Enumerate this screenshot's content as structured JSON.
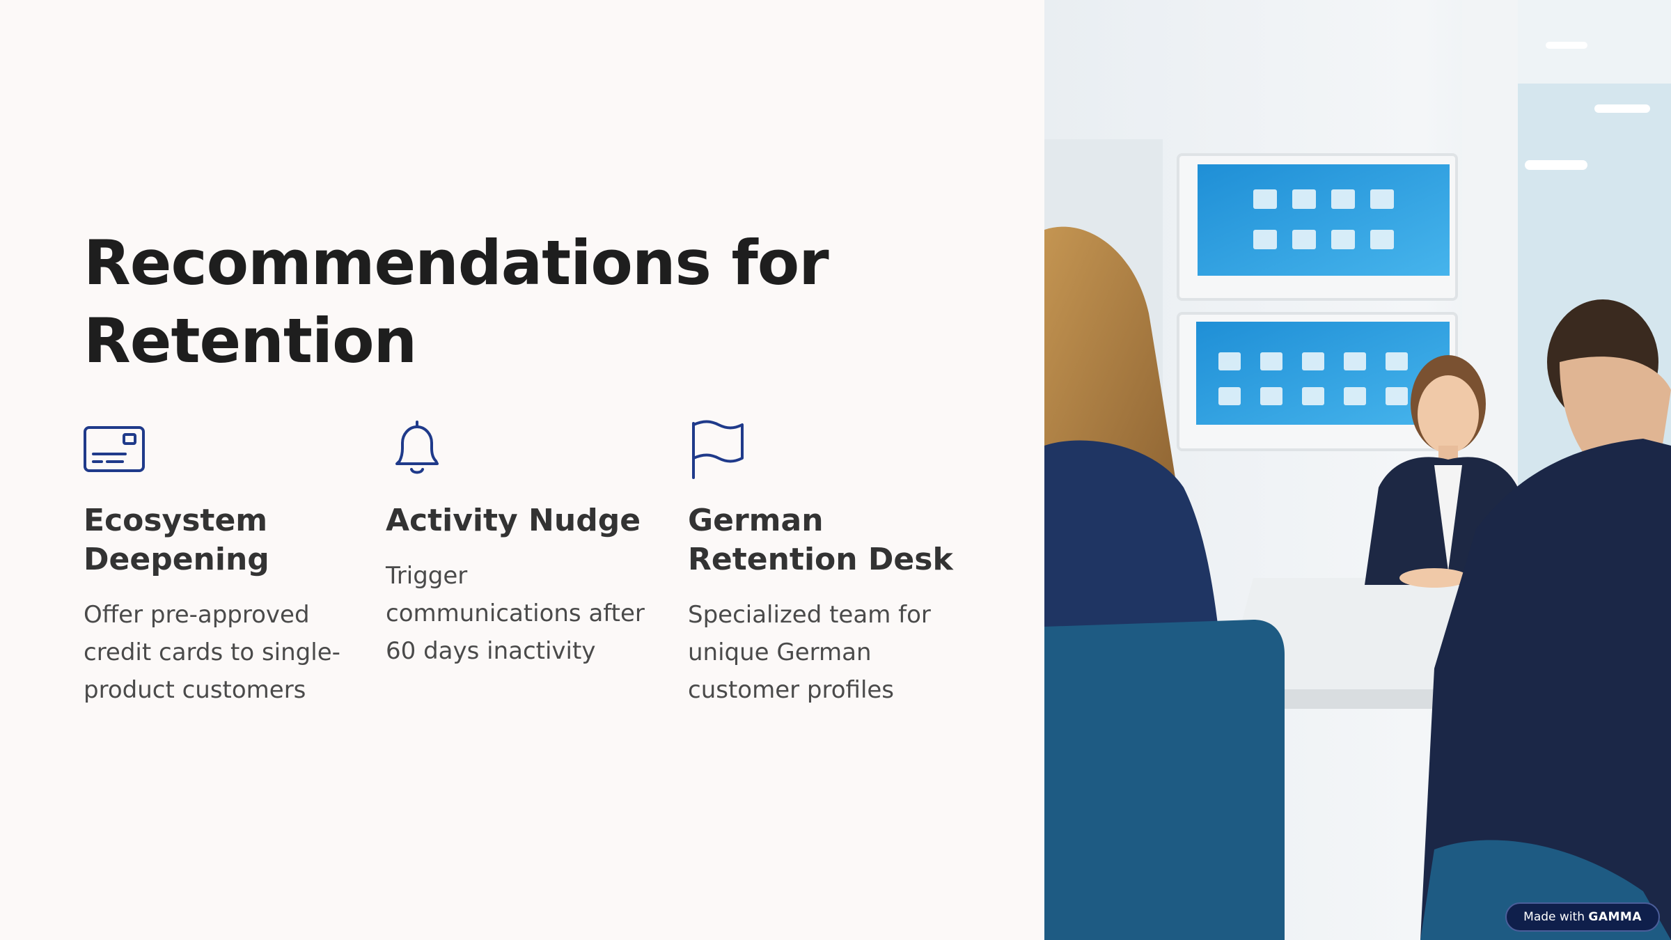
{
  "slide": {
    "title": "Recommendations for Retention",
    "colors": {
      "accent": "#1f3a8a",
      "title": "#1e1e1e",
      "body": "#4a4a4a",
      "background": "#fcf9f8"
    }
  },
  "recommendations": [
    {
      "icon": "credit-card-icon",
      "heading": "Ecosystem Deepening",
      "body": "Offer pre-approved credit cards to single-product customers"
    },
    {
      "icon": "bell-icon",
      "heading": "Activity Nudge",
      "body": "Trigger communications after 60 days inactivity"
    },
    {
      "icon": "flag-icon",
      "heading": "German Retention Desk",
      "body": "Specialized team for unique German customer profiles"
    }
  ],
  "badge": {
    "prefix": "Made with",
    "brand": "GAMMA"
  }
}
